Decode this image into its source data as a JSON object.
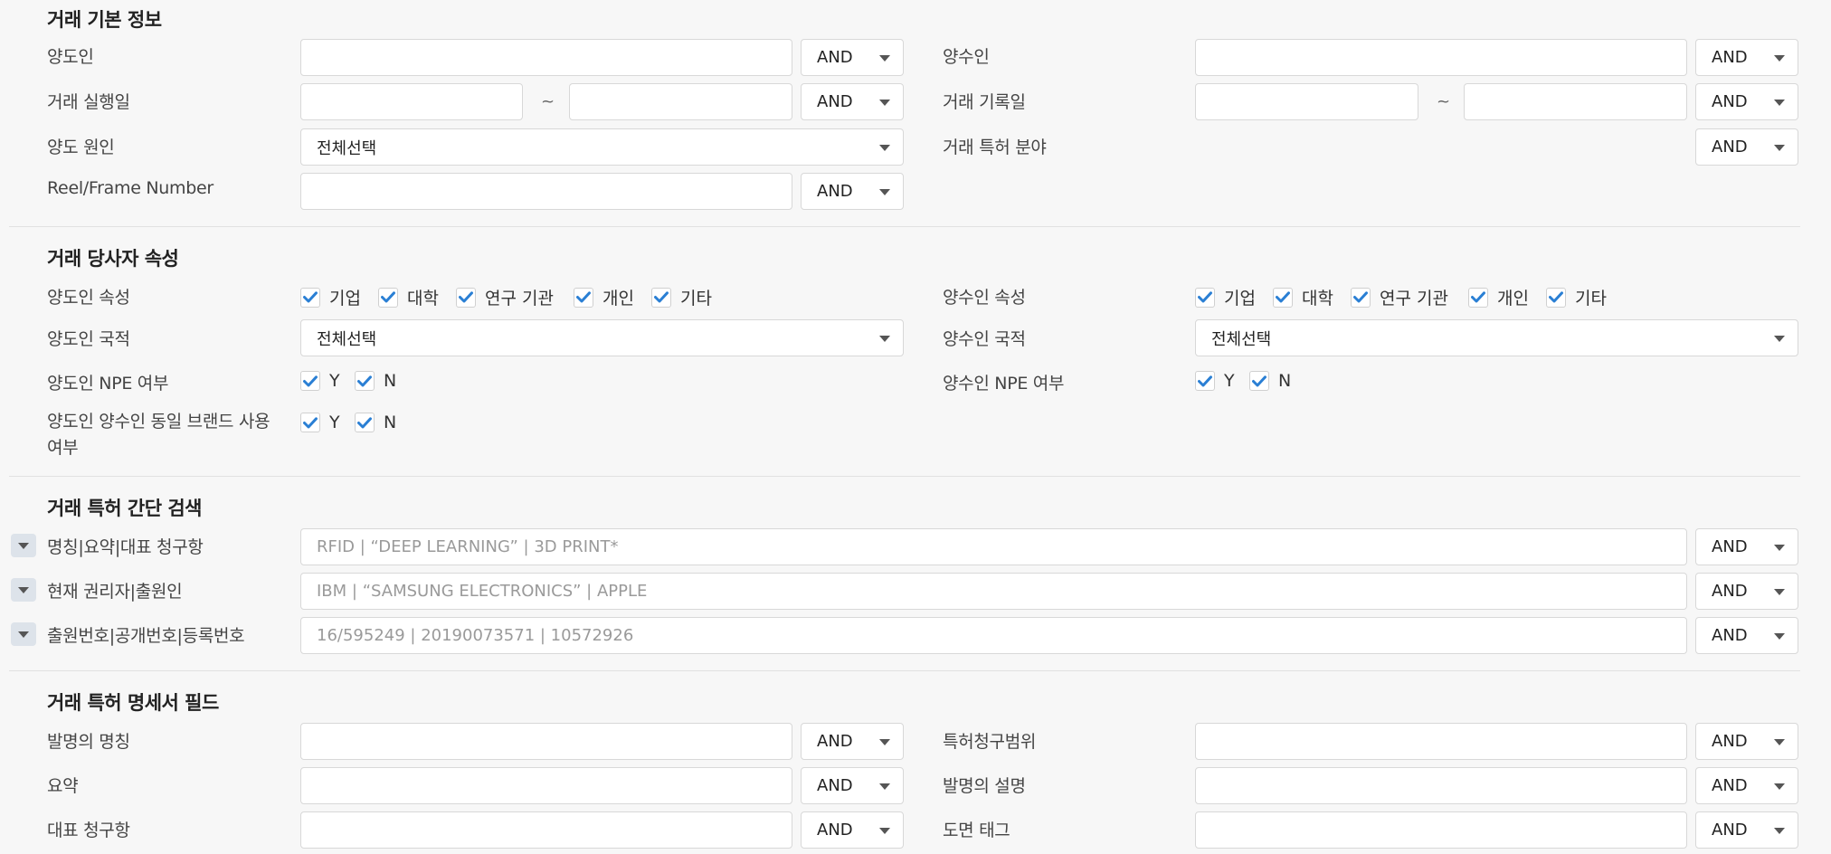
{
  "sections": {
    "basic": "거래 기본 정보",
    "parties": "거래 당사자 속성",
    "simple": "거래 특허 간단 검색",
    "spec": "거래 특허 명세서 필드"
  },
  "basic": {
    "assignor": "양도인",
    "assignee": "양수인",
    "exec_date": "거래 실행일",
    "record_date": "거래 기록일",
    "reason": "양도 원인",
    "field": "거래 특허 분야",
    "reel": "Reel/Frame Number",
    "all_select": "전체선택",
    "tilde": "~"
  },
  "op": "AND",
  "parties": {
    "assignor_attr": "양도인 속성",
    "assignee_attr": "양수인 속성",
    "assignor_nat": "양도인 국적",
    "assignee_nat": "양수인 국적",
    "assignor_npe": "양도인 NPE 여부",
    "assignee_npe": "양수인 NPE 여부",
    "same_brand": "양도인 양수인 동일 브랜드 사용 여부",
    "attrs": [
      "기업",
      "대학",
      "연구 기관",
      "개인",
      "기타"
    ],
    "yes": "Y",
    "no": "N",
    "all_select": "전체선택"
  },
  "simple": {
    "title_label": "명칭|요약|대표 청구항",
    "title_ph": "RFID | “DEEP LEARNING” | 3D PRINT*",
    "owner_label": "현재 권리자|출원인",
    "owner_ph": "IBM | “SAMSUNG ELECTRONICS” | APPLE",
    "number_label": "출원번호|공개번호|등록번호",
    "number_ph": "16/595249 | 20190073571 | 10572926"
  },
  "spec": {
    "invention_title": "발명의 명칭",
    "claims": "특허청구범위",
    "abstract": "요약",
    "description": "발명의 설명",
    "rep_claim": "대표 청구항",
    "drawing_tag": "도면 태그"
  },
  "colors": {
    "check": "#2a7fd4",
    "border": "#d8d8d8"
  }
}
